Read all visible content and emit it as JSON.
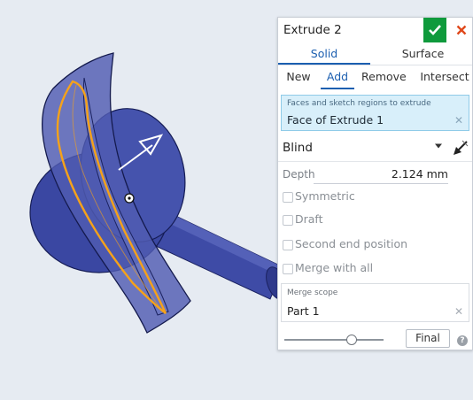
{
  "panel": {
    "title": "Extrude 2",
    "type_tabs": [
      "Solid",
      "Surface"
    ],
    "active_type": "Solid",
    "op_tabs": [
      "New",
      "Add",
      "Remove",
      "Intersect"
    ],
    "active_op": "Add",
    "faces": {
      "label": "Faces and sketch regions to extrude",
      "value": "Face of Extrude 1"
    },
    "end_type": "Blind",
    "depth": {
      "label": "Depth",
      "value": "2.124 mm"
    },
    "options": [
      "Symmetric",
      "Draft",
      "Second end position",
      "Merge with all"
    ],
    "merge_scope": {
      "label": "Merge scope",
      "value": "Part 1"
    },
    "slider_position": 0.69,
    "final_label": "Final"
  },
  "colors": {
    "accept": "#0f9a3c",
    "cancel": "#e0481b",
    "accent": "#1c5fb0",
    "selection": "#d8effa",
    "highlight": "#f5a21a"
  }
}
